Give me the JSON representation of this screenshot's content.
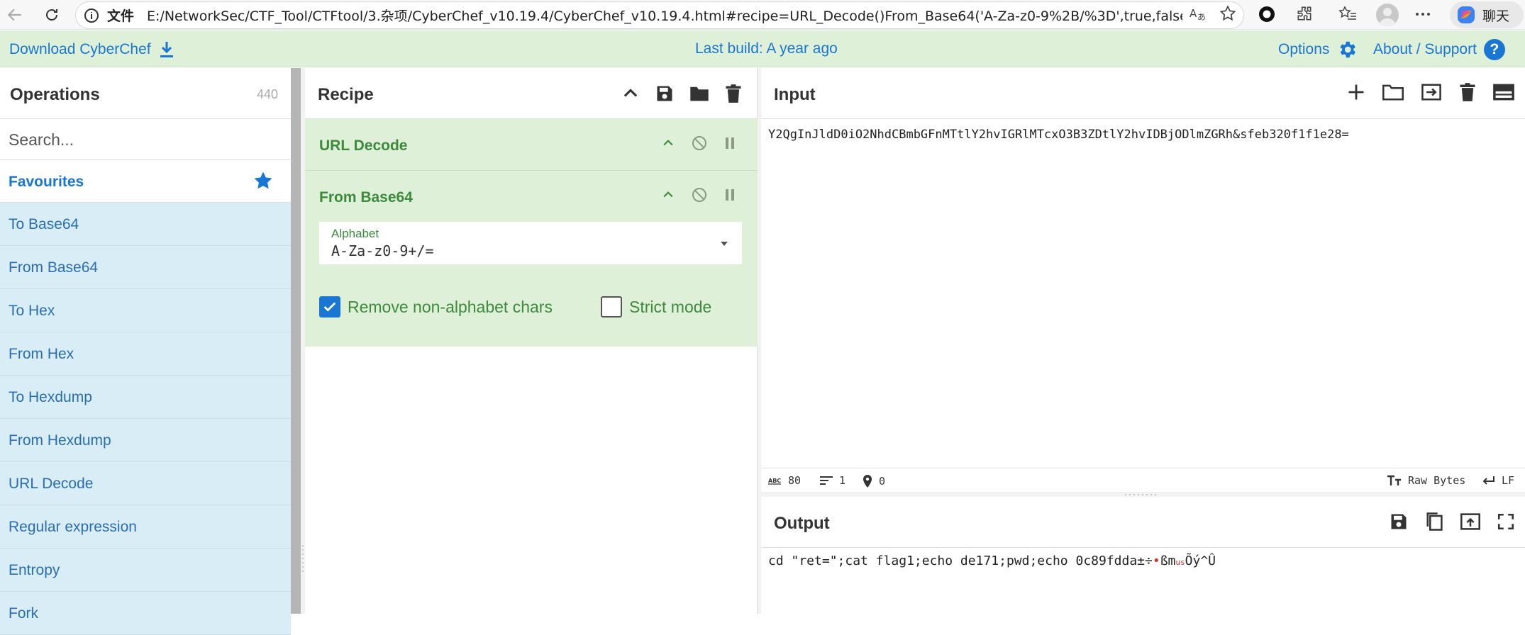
{
  "browser": {
    "scheme_label": "文件",
    "url": "E:/NetworkSec/CTF_Tool/CTFtool/3.杂项/CyberChef_v10.19.4/CyberChef_v10.19.4.html#recipe=URL_Decode()From_Base64('A-Za-z0-9%2B/%3D',true,false)&...",
    "copilot_label": "聊天"
  },
  "banner": {
    "download_label": "Download CyberChef",
    "last_build": "Last build: A year ago",
    "options_label": "Options",
    "about_label": "About / Support",
    "help_glyph": "?"
  },
  "operations": {
    "title": "Operations",
    "count": "440",
    "search_placeholder": "Search...",
    "favourites_label": "Favourites",
    "items": [
      {
        "label": "To Base64"
      },
      {
        "label": "From Base64"
      },
      {
        "label": "To Hex"
      },
      {
        "label": "From Hex"
      },
      {
        "label": "To Hexdump"
      },
      {
        "label": "From Hexdump"
      },
      {
        "label": "URL Decode"
      },
      {
        "label": "Regular expression"
      },
      {
        "label": "Entropy"
      },
      {
        "label": "Fork"
      }
    ]
  },
  "recipe": {
    "title": "Recipe",
    "ingredients": [
      {
        "name": "URL Decode"
      },
      {
        "name": "From Base64"
      }
    ],
    "alphabet_label": "Alphabet",
    "alphabet_value": "A-Za-z0-9+/=",
    "remove_non_alpha_label": "Remove non-alphabet chars",
    "remove_non_alpha_checked": true,
    "strict_mode_label": "Strict mode",
    "strict_mode_checked": false
  },
  "input": {
    "title": "Input",
    "text": "Y2QgInJldD0iO2NhdCBmbGFnMTtlY2hvIGRlMTcxO3B3ZDtlY2hvIDBjODlmZGRh&sfeb320f1f1e28="
  },
  "status": {
    "length": "80",
    "lines": "1",
    "position": "0",
    "encoding": "Raw Bytes",
    "eol": "LF"
  },
  "output": {
    "title": "Output",
    "text_prefix": "cd \"ret=\";cat flag1;echo de171;pwd;echo 0c89fdda±÷",
    "text_red1": "•",
    "text_mid": "ßm",
    "text_red2": "us",
    "text_suffix": "Õý^Û"
  },
  "colors": {
    "accent": "#1976d2",
    "recipe_bg": "#dff0d8",
    "recipe_text": "#3d8a3d",
    "op_item_bg": "#d9edf7"
  }
}
